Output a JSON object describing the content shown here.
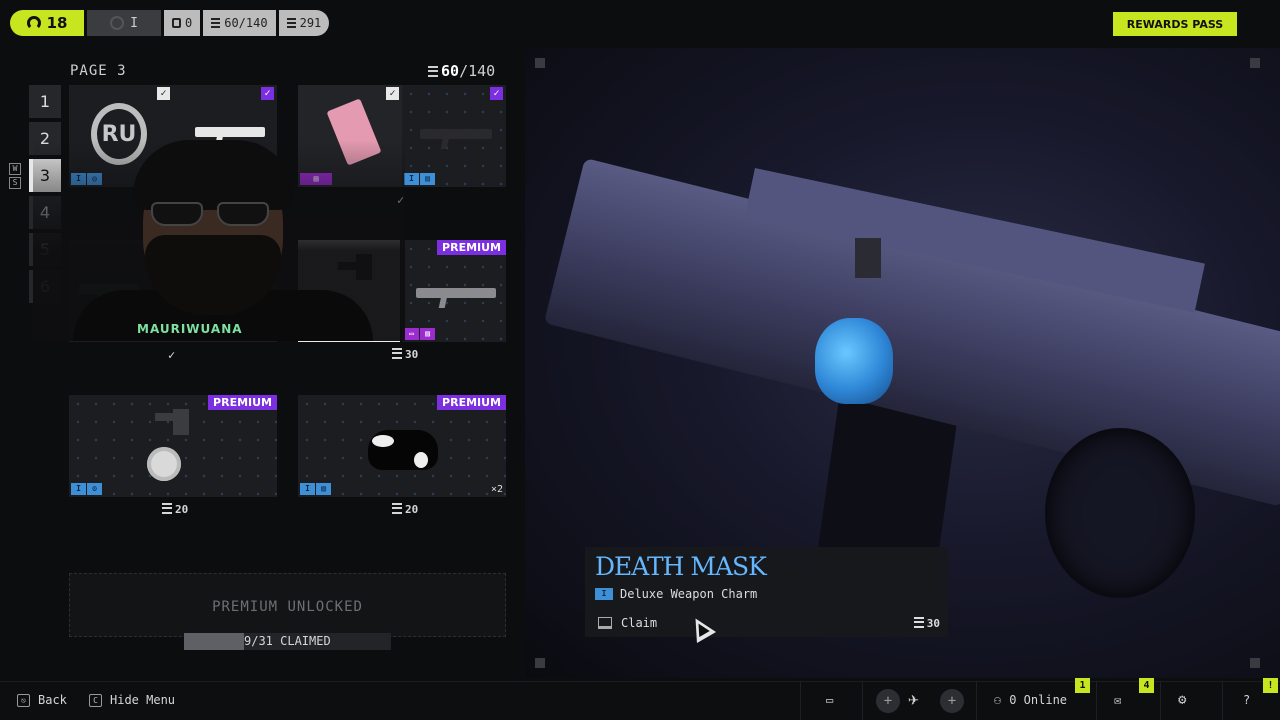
{
  "topbar": {
    "level": "18",
    "tier_label": "I",
    "stat_a": "0",
    "tokens": "60/140",
    "currency": "291",
    "rewards_pass": "REWARDS PASS"
  },
  "page": {
    "title": "PAGE 3",
    "count_current": "60",
    "count_total": "/140"
  },
  "page_nav": [
    "1",
    "2",
    "3",
    "4",
    "5",
    "6"
  ],
  "active_page": "3",
  "ws_keys": [
    "W",
    "S"
  ],
  "items": {
    "tile1_glyph": "RU",
    "cost_row2": "30",
    "cost_row3_left": "20",
    "cost_row3_right": "20",
    "premium_label": "PREMIUM",
    "qty_cow": "×2",
    "badge_tier": "I"
  },
  "streamer": {
    "name": "MAURIWUANA"
  },
  "premium_panel": {
    "label": "PREMIUM UNLOCKED",
    "claimed": "9/31 CLAIMED",
    "claimed_fraction": 0.29
  },
  "detail": {
    "title": "DEATH MASK",
    "tier": "I",
    "type": "Deluxe Weapon Charm",
    "claim": "Claim",
    "cost": "30"
  },
  "bottombar": {
    "back": "Back",
    "hide_menu": "Hide Menu",
    "online": "0 Online",
    "notif_a": "1",
    "notif_b": "4",
    "notif_c": "!"
  },
  "icons": [
    "headset-icon",
    "chat-icon",
    "party-icon",
    "mail-icon",
    "settings-icon",
    "help-icon"
  ]
}
